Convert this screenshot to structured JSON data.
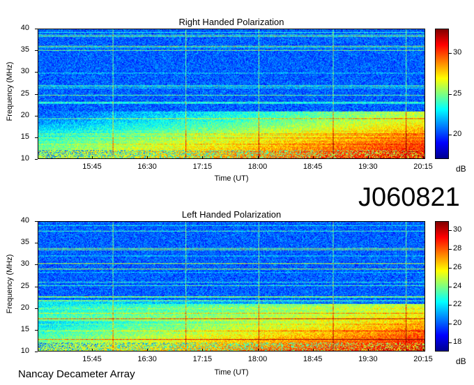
{
  "observation_id": "J060821",
  "footer": "Nancay Decameter Array",
  "chart_data": [
    {
      "type": "heatmap",
      "title": "Right Handed Polarization",
      "xlabel": "Time (UT)",
      "ylabel": "Frequency (MHz)",
      "x_ticks": [
        "15:45",
        "16:30",
        "17:15",
        "18:00",
        "18:45",
        "19:30",
        "20:15"
      ],
      "y_ticks": [
        10,
        15,
        20,
        25,
        30,
        35,
        40
      ],
      "ylim": [
        10,
        40
      ],
      "colorbar": {
        "unit": "dB",
        "ticks": [
          20,
          25,
          30
        ],
        "range": [
          17,
          33
        ]
      },
      "colormap": "jet",
      "grid": false
    },
    {
      "type": "heatmap",
      "title": "Left Handed Polarization",
      "xlabel": "Time (UT)",
      "ylabel": "Frequency (MHz)",
      "x_ticks": [
        "15:45",
        "16:30",
        "17:15",
        "18:00",
        "18:45",
        "19:30",
        "20:15"
      ],
      "y_ticks": [
        10,
        15,
        20,
        25,
        30,
        35,
        40
      ],
      "ylim": [
        10,
        40
      ],
      "colorbar": {
        "unit": "dB",
        "ticks": [
          18,
          20,
          22,
          24,
          26,
          28,
          30
        ],
        "range": [
          17,
          31
        ]
      },
      "colormap": "jet",
      "grid": false
    }
  ]
}
